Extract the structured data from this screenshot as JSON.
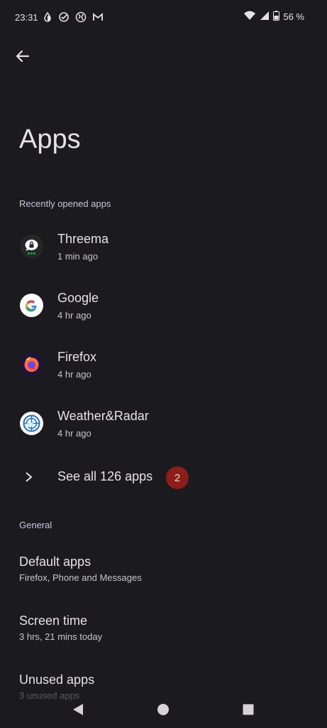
{
  "status_bar": {
    "time": "23:31",
    "battery": "56 %",
    "left_icons": [
      "data-saver-icon",
      "check-circle-icon",
      "vpn-globe-icon",
      "gmail-icon"
    ],
    "right_icons": [
      "wifi-icon",
      "signal-icon",
      "battery-icon"
    ]
  },
  "header": {
    "title": "Apps"
  },
  "recent": {
    "header": "Recently opened apps",
    "items": [
      {
        "name": "Threema",
        "time": "1 min ago",
        "icon": "threema-icon"
      },
      {
        "name": "Google",
        "time": "4 hr ago",
        "icon": "google-icon"
      },
      {
        "name": "Firefox",
        "time": "4 hr ago",
        "icon": "firefox-icon"
      },
      {
        "name": "Weather&Radar",
        "time": "4 hr ago",
        "icon": "weather-radar-icon"
      }
    ]
  },
  "see_all": {
    "label": "See all 126 apps",
    "badge": "2"
  },
  "general": {
    "header": "General",
    "items": [
      {
        "title": "Default apps",
        "subtitle": "Firefox, Phone and Messages"
      },
      {
        "title": "Screen time",
        "subtitle": "3 hrs, 21 mins today"
      },
      {
        "title": "Unused apps",
        "subtitle": "3 unused apps"
      }
    ]
  },
  "colors": {
    "background": "#1b1b1f",
    "badge": "#8c1d18",
    "text_primary": "#e6e1e6",
    "text_secondary": "#c9c5ca"
  }
}
